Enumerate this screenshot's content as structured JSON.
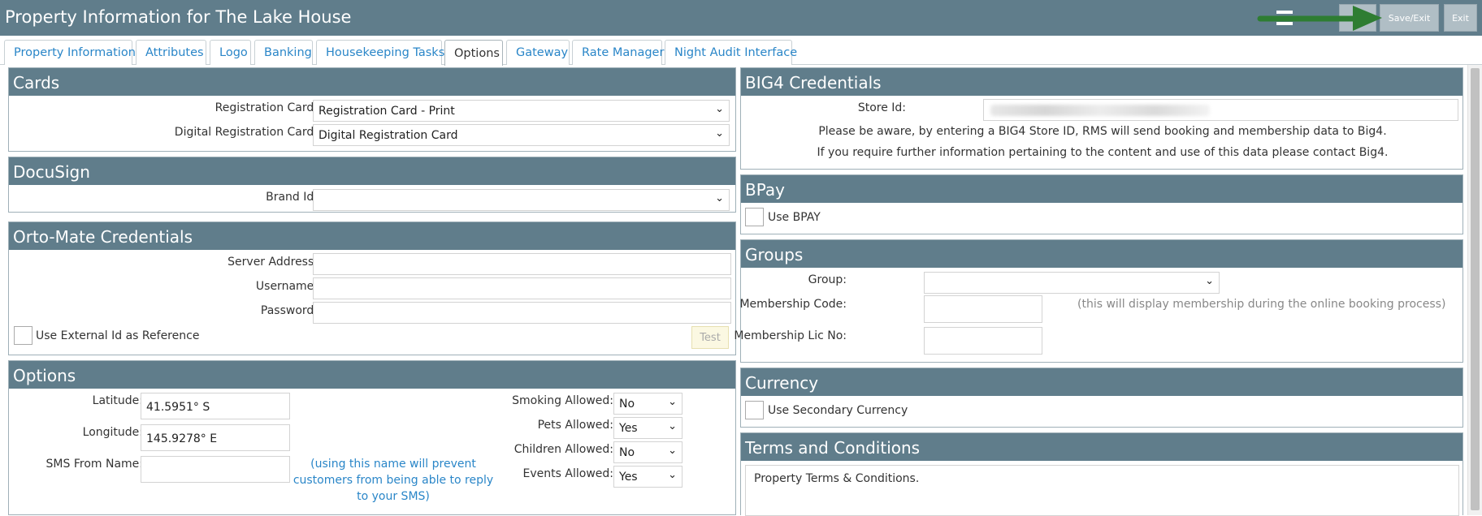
{
  "window": {
    "title": "Property Information for The Lake House"
  },
  "toolbar": {
    "save_exit_label": "Save/Exit",
    "exit_label": "Exit"
  },
  "tabs": [
    {
      "label": "Property Information"
    },
    {
      "label": "Attributes"
    },
    {
      "label": "Logo"
    },
    {
      "label": "Banking"
    },
    {
      "label": "Housekeeping Tasks"
    },
    {
      "label": "Options",
      "active": true
    },
    {
      "label": "Gateway"
    },
    {
      "label": "Rate Manager"
    },
    {
      "label": "Night Audit Interface"
    }
  ],
  "cards": {
    "header": "Cards",
    "registration_card_label": "Registration Card:",
    "registration_card_value": "Registration Card - Print",
    "digital_registration_card_label": "Digital Registration Card:",
    "digital_registration_card_value": "Digital Registration Card"
  },
  "docusign": {
    "header": "DocuSign",
    "brand_id_label": "Brand Id:",
    "brand_id_value": ""
  },
  "ortomate": {
    "header": "Orto-Mate Credentials",
    "server_address_label": "Server Address:",
    "username_label": "Username:",
    "password_label": "Password:",
    "use_external_id_label": "Use External Id as Reference",
    "test_button_label": "Test"
  },
  "options": {
    "header": "Options",
    "latitude_label": "Latitude:",
    "latitude_value": "41.5951° S",
    "longitude_label": "Longitude:",
    "longitude_value": "145.9278° E",
    "sms_from_name_label": "SMS From Name:",
    "sms_note_line1": "(using this name will prevent",
    "sms_note_line2": "customers from being able to reply",
    "sms_note_line3": "to your SMS)",
    "smoking_allowed_label": "Smoking Allowed:",
    "smoking_allowed_value": "No",
    "pets_allowed_label": "Pets Allowed:",
    "pets_allowed_value": "Yes",
    "children_allowed_label": "Children Allowed:",
    "children_allowed_value": "No",
    "events_allowed_label": "Events Allowed:",
    "events_allowed_value": "Yes"
  },
  "big4": {
    "header": "BIG4 Credentials",
    "store_id_label": "Store Id:",
    "notice_line1": "Please be aware, by entering a BIG4 Store ID, RMS will send booking and membership data to Big4.",
    "notice_line2": "If you require further information pertaining to the content and use of this data please contact Big4."
  },
  "bpay": {
    "header": "BPay",
    "use_bpay_label": "Use BPAY"
  },
  "groups": {
    "header": "Groups",
    "group_label": "Group:",
    "membership_code_label": "Membership Code:",
    "membership_note": "(this will display membership during the online booking process)",
    "membership_lic_no_label": "Membership Lic No:"
  },
  "currency": {
    "header": "Currency",
    "use_secondary_label": "Use Secondary Currency"
  },
  "terms": {
    "header": "Terms and Conditions",
    "text": "Property Terms & Conditions."
  },
  "colors": {
    "header_bg": "#607d8b",
    "link_blue": "#2a86c8",
    "arrow_green": "#2e7d32"
  }
}
